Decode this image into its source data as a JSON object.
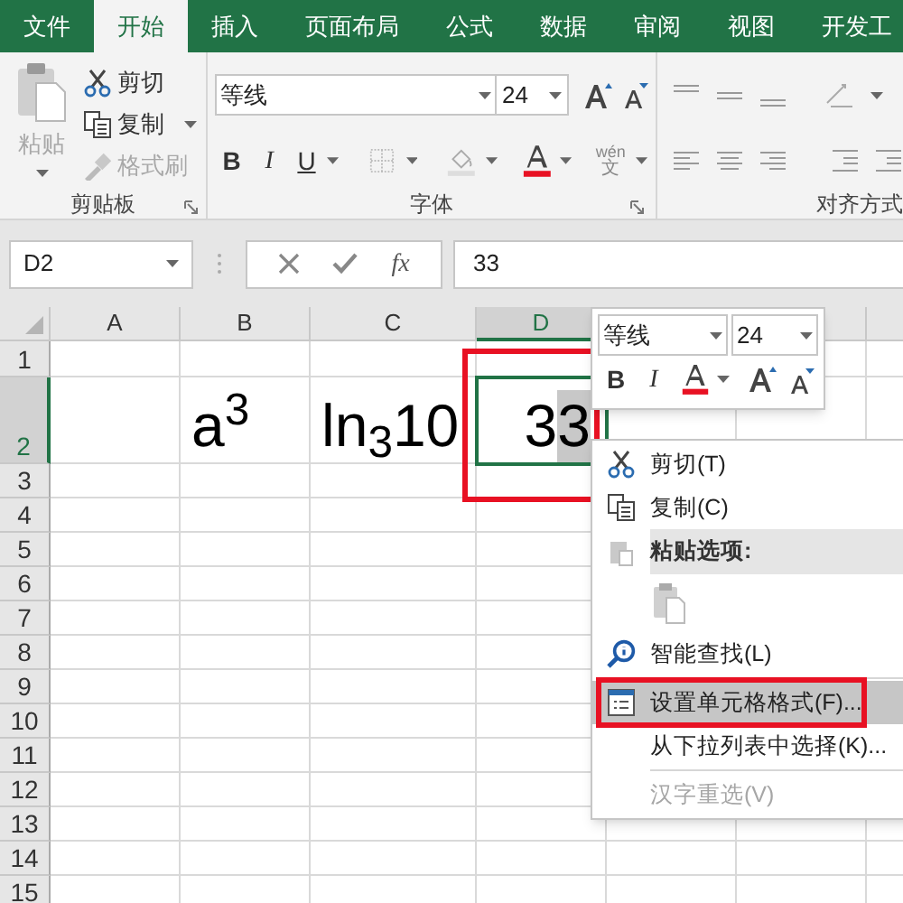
{
  "tabs": [
    {
      "label": "文件",
      "selected": false
    },
    {
      "label": "开始",
      "selected": true
    },
    {
      "label": "插入",
      "selected": false
    },
    {
      "label": "页面布局",
      "selected": false
    },
    {
      "label": "公式",
      "selected": false
    },
    {
      "label": "数据",
      "selected": false
    },
    {
      "label": "审阅",
      "selected": false
    },
    {
      "label": "视图",
      "selected": false
    },
    {
      "label": "开发工",
      "selected": false
    }
  ],
  "ribbon": {
    "clipboard": {
      "label": "剪贴板",
      "paste": {
        "label": "粘贴",
        "disabled": true
      },
      "items": [
        {
          "label": "剪切",
          "disabled": false
        },
        {
          "label": "复制",
          "disabled": false
        },
        {
          "label": "格式刷",
          "disabled": true
        }
      ]
    },
    "font": {
      "label": "字体",
      "font_name": "等线",
      "font_size": "24",
      "style_buttons": [
        "B",
        "I",
        "U"
      ],
      "phonetic_label": "wén",
      "phonetic_char": "文"
    },
    "alignment": {
      "label": "对齐方式"
    }
  },
  "formula_bar": {
    "name_box": "D2",
    "fx": "fx",
    "value": "33"
  },
  "sheet": {
    "columns": [
      {
        "label": "A",
        "selected": false
      },
      {
        "label": "B",
        "selected": false
      },
      {
        "label": "C",
        "selected": false
      },
      {
        "label": "D",
        "selected": true
      }
    ],
    "rows": [
      {
        "label": "1",
        "selected": false
      },
      {
        "label": "2",
        "selected": true,
        "cells": [
          {
            "kind": "empty"
          },
          {
            "kind": "text",
            "text": "a$^{3}$"
          },
          {
            "kind": "text",
            "text": "ln$_{3}$10"
          },
          {
            "kind": "editing",
            "text": "33",
            "last_char_selected": true,
            "active": true,
            "annotated": true
          }
        ]
      },
      {
        "label": "3",
        "selected": false
      },
      {
        "label": "4",
        "selected": false
      },
      {
        "label": "5",
        "selected": false
      },
      {
        "label": "6",
        "selected": false
      },
      {
        "label": "7",
        "selected": false
      },
      {
        "label": "8",
        "selected": false
      },
      {
        "label": "9",
        "selected": false
      },
      {
        "label": "10",
        "selected": false
      },
      {
        "label": "11",
        "selected": false
      },
      {
        "label": "12",
        "selected": false
      },
      {
        "label": "13",
        "selected": false
      },
      {
        "label": "14",
        "selected": false
      },
      {
        "label": "15",
        "selected": false
      }
    ]
  },
  "mini_toolbar": {
    "font_name": "等线",
    "font_size": "24",
    "buttons": [
      "B",
      "I"
    ]
  },
  "context_menu": [
    {
      "kind": "item",
      "label": "剪切(T)",
      "selected": false,
      "disabled": false,
      "annotated": false
    },
    {
      "kind": "item",
      "label": "复制(C)",
      "selected": false,
      "disabled": false,
      "annotated": false
    },
    {
      "kind": "header",
      "label": "粘贴选项:"
    },
    {
      "kind": "paste_options"
    },
    {
      "kind": "item",
      "label": "智能查找(L)",
      "selected": false,
      "disabled": false,
      "annotated": false
    },
    {
      "kind": "separator"
    },
    {
      "kind": "item",
      "label": "设置单元格格式(F)...",
      "selected": true,
      "disabled": false,
      "annotated": true
    },
    {
      "kind": "item",
      "label": "从下拉列表中选择(K)...",
      "selected": false,
      "disabled": false,
      "annotated": false
    },
    {
      "kind": "separator"
    },
    {
      "kind": "item",
      "label": "汉字重选(V)",
      "selected": false,
      "disabled": true,
      "annotated": false
    }
  ]
}
